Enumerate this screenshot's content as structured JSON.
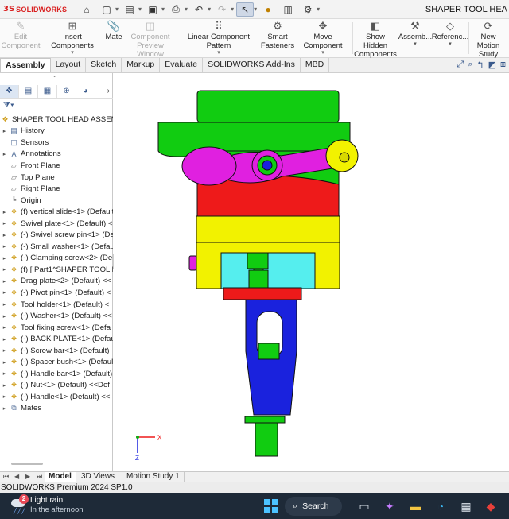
{
  "app": {
    "brand": "SOLIDWORKS",
    "brand_mark": "3S",
    "window_title": "SHAPER TOOL HEA"
  },
  "quick_access": [
    {
      "name": "home-icon",
      "glyph": "⌂"
    },
    {
      "name": "new-document-icon",
      "glyph": "▢"
    },
    {
      "name": "open-icon",
      "glyph": "▤"
    },
    {
      "name": "save-icon",
      "glyph": "▣"
    },
    {
      "name": "print-icon",
      "glyph": "⎙"
    },
    {
      "name": "undo-icon",
      "glyph": "↶"
    },
    {
      "name": "redo-icon",
      "glyph": "↷"
    },
    {
      "name": "select-icon",
      "glyph": "↖"
    },
    {
      "name": "rebuild-icon",
      "glyph": "●"
    },
    {
      "name": "file-properties-icon",
      "glyph": "▥"
    },
    {
      "name": "options-icon",
      "glyph": "⚙"
    }
  ],
  "ribbon": {
    "edit_component": "Edit Component",
    "insert_components": "Insert Components",
    "mate": "Mate",
    "component_preview": "Component Preview Window",
    "linear_pattern": "Linear Component Pattern",
    "smart_fasteners": "Smart Fasteners",
    "move_component": "Move Component",
    "show_hidden": "Show Hidden Components",
    "assembly": "Assemb...",
    "reference": "Referenc...",
    "new_motion_study": "New Motion Study"
  },
  "tabs": [
    "Assembly",
    "Layout",
    "Sketch",
    "Markup",
    "Evaluate",
    "SOLIDWORKS Add-Ins",
    "MBD"
  ],
  "tree": {
    "root": "SHAPER TOOL HEAD ASSEMBLY",
    "items": [
      {
        "label": "History",
        "icon": "history-icon",
        "glyph": "▤",
        "kind": "gen",
        "expand": "▸"
      },
      {
        "label": "Sensors",
        "icon": "sensors-icon",
        "glyph": "◫",
        "kind": "gen",
        "expand": ""
      },
      {
        "label": "Annotations",
        "icon": "annotations-icon",
        "glyph": "A",
        "kind": "gen",
        "expand": "▸"
      },
      {
        "label": "Front Plane",
        "icon": "plane-icon",
        "glyph": "▱",
        "kind": "plane",
        "expand": ""
      },
      {
        "label": "Top Plane",
        "icon": "plane-icon",
        "glyph": "▱",
        "kind": "plane",
        "expand": ""
      },
      {
        "label": "Right Plane",
        "icon": "plane-icon",
        "glyph": "▱",
        "kind": "plane",
        "expand": ""
      },
      {
        "label": "Origin",
        "icon": "origin-icon",
        "glyph": "┗",
        "kind": "plane",
        "expand": ""
      },
      {
        "label": "(f) vertical slide<1> (Default",
        "icon": "part-icon",
        "glyph": "❖",
        "kind": "part",
        "expand": "▸"
      },
      {
        "label": "Swivel plate<1> (Default) <",
        "icon": "part-icon",
        "glyph": "❖",
        "kind": "part",
        "expand": "▸"
      },
      {
        "label": "(-) Swivel screw pin<1> (De",
        "icon": "part-icon",
        "glyph": "❖",
        "kind": "part",
        "expand": "▸"
      },
      {
        "label": "(-) Small washer<1> (Defau",
        "icon": "part-icon",
        "glyph": "❖",
        "kind": "part",
        "expand": "▸"
      },
      {
        "label": "(-) Clamping screw<2> (De",
        "icon": "part-icon",
        "glyph": "❖",
        "kind": "part",
        "expand": "▸"
      },
      {
        "label": "(f) [ Part1^SHAPER TOOL H",
        "icon": "part-icon",
        "glyph": "❖",
        "kind": "part",
        "expand": "▸"
      },
      {
        "label": "Drag plate<2> (Default) <<",
        "icon": "part-icon",
        "glyph": "❖",
        "kind": "part",
        "expand": "▸"
      },
      {
        "label": "(-) Pivot pin<1> (Default) <",
        "icon": "part-icon",
        "glyph": "❖",
        "kind": "part",
        "expand": "▸"
      },
      {
        "label": "Tool holder<1> (Default) <",
        "icon": "part-icon",
        "glyph": "❖",
        "kind": "part",
        "expand": "▸"
      },
      {
        "label": "(-) Washer<1> (Default) <<",
        "icon": "part-icon",
        "glyph": "❖",
        "kind": "part",
        "expand": "▸"
      },
      {
        "label": "Tool fixing screw<1> (Defa",
        "icon": "part-icon",
        "glyph": "❖",
        "kind": "part",
        "expand": "▸"
      },
      {
        "label": "(-) BACK PLATE<1> (Default",
        "icon": "part-icon",
        "glyph": "❖",
        "kind": "part",
        "expand": "▸"
      },
      {
        "label": "(-) Screw bar<1> (Default)",
        "icon": "part-icon",
        "glyph": "❖",
        "kind": "part",
        "expand": "▸"
      },
      {
        "label": "(-) Spacer bush<1> (Defaul",
        "icon": "part-icon",
        "glyph": "❖",
        "kind": "part",
        "expand": "▸"
      },
      {
        "label": "(-) Handle bar<1> (Default)",
        "icon": "part-icon",
        "glyph": "❖",
        "kind": "part",
        "expand": "▸"
      },
      {
        "label": "(-) Nut<1> (Default) <<Def",
        "icon": "part-icon",
        "glyph": "❖",
        "kind": "part",
        "expand": "▸"
      },
      {
        "label": "(-) Handle<1> (Default) <<",
        "icon": "part-icon",
        "glyph": "❖",
        "kind": "part",
        "expand": "▸"
      },
      {
        "label": "Mates",
        "icon": "mates-icon",
        "glyph": "⧉",
        "kind": "gen",
        "expand": "▸"
      }
    ]
  },
  "triad": {
    "x": "X",
    "z": "Z"
  },
  "bottom_tabs": [
    "Model",
    "3D Views",
    "Motion Study 1"
  ],
  "status": "SOLIDWORKS Premium 2024 SP1.0",
  "taskbar": {
    "weather_title": "Light rain",
    "weather_sub": "In the afternoon",
    "notification_count": "2",
    "search_label": "Search"
  },
  "colors": {
    "green": "#11cc11",
    "magenta": "#e020e0",
    "red": "#ee1a1a",
    "yellow": "#f2f200",
    "cyan": "#55eeee",
    "blue": "#1a22dd",
    "accent_red": "#d92020",
    "taskbar": "#1e2a38"
  }
}
